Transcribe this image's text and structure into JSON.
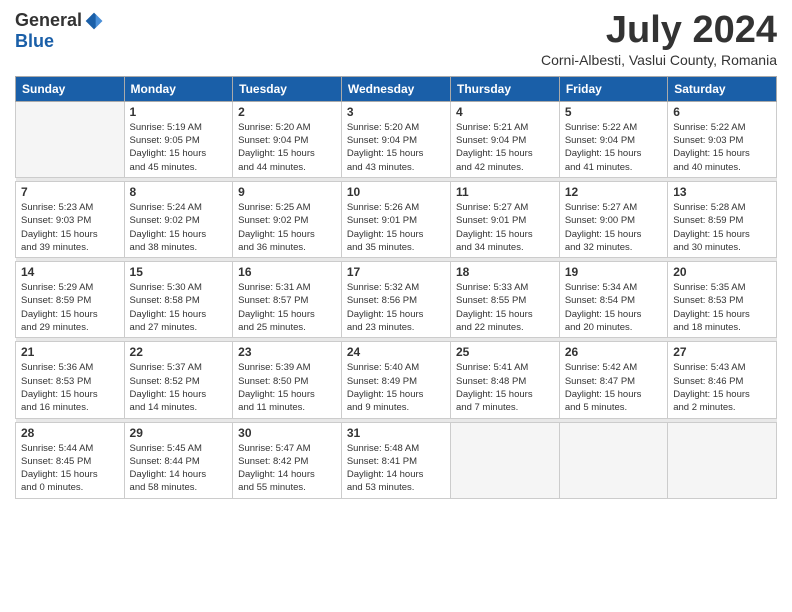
{
  "header": {
    "logo_general": "General",
    "logo_blue": "Blue",
    "month_title": "July 2024",
    "location": "Corni-Albesti, Vaslui County, Romania"
  },
  "days_of_week": [
    "Sunday",
    "Monday",
    "Tuesday",
    "Wednesday",
    "Thursday",
    "Friday",
    "Saturday"
  ],
  "weeks": [
    [
      {
        "day": "",
        "info": ""
      },
      {
        "day": "1",
        "info": "Sunrise: 5:19 AM\nSunset: 9:05 PM\nDaylight: 15 hours\nand 45 minutes."
      },
      {
        "day": "2",
        "info": "Sunrise: 5:20 AM\nSunset: 9:04 PM\nDaylight: 15 hours\nand 44 minutes."
      },
      {
        "day": "3",
        "info": "Sunrise: 5:20 AM\nSunset: 9:04 PM\nDaylight: 15 hours\nand 43 minutes."
      },
      {
        "day": "4",
        "info": "Sunrise: 5:21 AM\nSunset: 9:04 PM\nDaylight: 15 hours\nand 42 minutes."
      },
      {
        "day": "5",
        "info": "Sunrise: 5:22 AM\nSunset: 9:04 PM\nDaylight: 15 hours\nand 41 minutes."
      },
      {
        "day": "6",
        "info": "Sunrise: 5:22 AM\nSunset: 9:03 PM\nDaylight: 15 hours\nand 40 minutes."
      }
    ],
    [
      {
        "day": "7",
        "info": "Sunrise: 5:23 AM\nSunset: 9:03 PM\nDaylight: 15 hours\nand 39 minutes."
      },
      {
        "day": "8",
        "info": "Sunrise: 5:24 AM\nSunset: 9:02 PM\nDaylight: 15 hours\nand 38 minutes."
      },
      {
        "day": "9",
        "info": "Sunrise: 5:25 AM\nSunset: 9:02 PM\nDaylight: 15 hours\nand 36 minutes."
      },
      {
        "day": "10",
        "info": "Sunrise: 5:26 AM\nSunset: 9:01 PM\nDaylight: 15 hours\nand 35 minutes."
      },
      {
        "day": "11",
        "info": "Sunrise: 5:27 AM\nSunset: 9:01 PM\nDaylight: 15 hours\nand 34 minutes."
      },
      {
        "day": "12",
        "info": "Sunrise: 5:27 AM\nSunset: 9:00 PM\nDaylight: 15 hours\nand 32 minutes."
      },
      {
        "day": "13",
        "info": "Sunrise: 5:28 AM\nSunset: 8:59 PM\nDaylight: 15 hours\nand 30 minutes."
      }
    ],
    [
      {
        "day": "14",
        "info": "Sunrise: 5:29 AM\nSunset: 8:59 PM\nDaylight: 15 hours\nand 29 minutes."
      },
      {
        "day": "15",
        "info": "Sunrise: 5:30 AM\nSunset: 8:58 PM\nDaylight: 15 hours\nand 27 minutes."
      },
      {
        "day": "16",
        "info": "Sunrise: 5:31 AM\nSunset: 8:57 PM\nDaylight: 15 hours\nand 25 minutes."
      },
      {
        "day": "17",
        "info": "Sunrise: 5:32 AM\nSunset: 8:56 PM\nDaylight: 15 hours\nand 23 minutes."
      },
      {
        "day": "18",
        "info": "Sunrise: 5:33 AM\nSunset: 8:55 PM\nDaylight: 15 hours\nand 22 minutes."
      },
      {
        "day": "19",
        "info": "Sunrise: 5:34 AM\nSunset: 8:54 PM\nDaylight: 15 hours\nand 20 minutes."
      },
      {
        "day": "20",
        "info": "Sunrise: 5:35 AM\nSunset: 8:53 PM\nDaylight: 15 hours\nand 18 minutes."
      }
    ],
    [
      {
        "day": "21",
        "info": "Sunrise: 5:36 AM\nSunset: 8:53 PM\nDaylight: 15 hours\nand 16 minutes."
      },
      {
        "day": "22",
        "info": "Sunrise: 5:37 AM\nSunset: 8:52 PM\nDaylight: 15 hours\nand 14 minutes."
      },
      {
        "day": "23",
        "info": "Sunrise: 5:39 AM\nSunset: 8:50 PM\nDaylight: 15 hours\nand 11 minutes."
      },
      {
        "day": "24",
        "info": "Sunrise: 5:40 AM\nSunset: 8:49 PM\nDaylight: 15 hours\nand 9 minutes."
      },
      {
        "day": "25",
        "info": "Sunrise: 5:41 AM\nSunset: 8:48 PM\nDaylight: 15 hours\nand 7 minutes."
      },
      {
        "day": "26",
        "info": "Sunrise: 5:42 AM\nSunset: 8:47 PM\nDaylight: 15 hours\nand 5 minutes."
      },
      {
        "day": "27",
        "info": "Sunrise: 5:43 AM\nSunset: 8:46 PM\nDaylight: 15 hours\nand 2 minutes."
      }
    ],
    [
      {
        "day": "28",
        "info": "Sunrise: 5:44 AM\nSunset: 8:45 PM\nDaylight: 15 hours\nand 0 minutes."
      },
      {
        "day": "29",
        "info": "Sunrise: 5:45 AM\nSunset: 8:44 PM\nDaylight: 14 hours\nand 58 minutes."
      },
      {
        "day": "30",
        "info": "Sunrise: 5:47 AM\nSunset: 8:42 PM\nDaylight: 14 hours\nand 55 minutes."
      },
      {
        "day": "31",
        "info": "Sunrise: 5:48 AM\nSunset: 8:41 PM\nDaylight: 14 hours\nand 53 minutes."
      },
      {
        "day": "",
        "info": ""
      },
      {
        "day": "",
        "info": ""
      },
      {
        "day": "",
        "info": ""
      }
    ]
  ]
}
